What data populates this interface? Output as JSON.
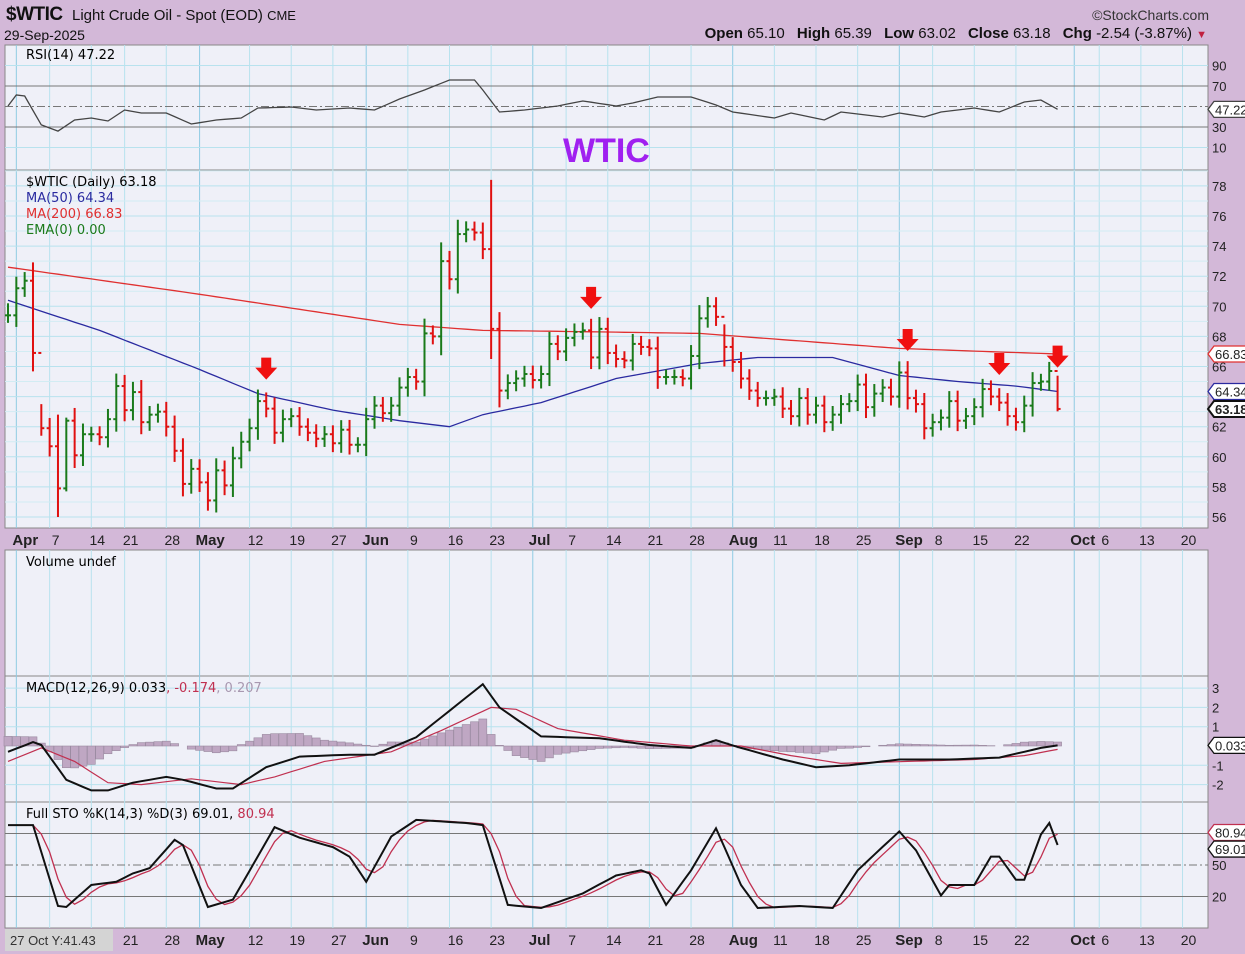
{
  "header": {
    "symbol": "$WTIC",
    "description": "Light Crude Oil - Spot (EOD)",
    "exchange": "CME",
    "date": "29-Sep-2025",
    "copyright": "©StockCharts.com",
    "open_label": "Open",
    "open": "65.10",
    "high_label": "High",
    "high": "65.39",
    "low_label": "Low",
    "low": "63.02",
    "close_label": "Close",
    "close": "63.18",
    "chg_label": "Chg",
    "chg": "-2.54 (-3.87%)"
  },
  "annotation_title": "WTIC",
  "tooltip": "27 Oct Y:41.43",
  "colors": {
    "up": "#1a7a1a",
    "down": "#e01010",
    "ma50": "#2a2aa0",
    "ma200": "#e03030",
    "title": "#a020f0",
    "signal": "#c03050",
    "hist": "#bfa7c3"
  },
  "chart_data": {
    "type": "ohlc",
    "start_date": "31-Mar-2025",
    "end_date": "29-Sep-2025",
    "closes": [
      69.4,
      71.2,
      71.7,
      66.9,
      61.9,
      60.7,
      57.9,
      62.4,
      60.1,
      61.5,
      61.5,
      61.3,
      62.5,
      64.7,
      63.1,
      64.3,
      62.3,
      62.8,
      63.0,
      62.0,
      60.4,
      58.2,
      59.2,
      58.3,
      57.1,
      59.1,
      58.1,
      59.9,
      61.0,
      61.9,
      63.7,
      63.2,
      61.6,
      62.5,
      62.7,
      62.0,
      61.6,
      61.2,
      61.5,
      60.9,
      61.8,
      60.8,
      60.8,
      62.5,
      63.4,
      62.9,
      63.4,
      64.6,
      65.3,
      65.0,
      68.2,
      68.0,
      73.0,
      71.8,
      74.8,
      75.1,
      74.9,
      73.8,
      68.5,
      64.4,
      64.9,
      65.2,
      65.5,
      65.1,
      65.5,
      67.5,
      67.0,
      67.9,
      68.3,
      68.4,
      66.6,
      68.5,
      66.9,
      66.5,
      66.4,
      67.5,
      67.3,
      67.2,
      65.3,
      65.3,
      65.3,
      65.2,
      66.7,
      69.2,
      70.0,
      69.3,
      67.3,
      66.3,
      65.2,
      64.4,
      63.9,
      63.9,
      64.0,
      63.2,
      62.7,
      63.9,
      62.8,
      63.4,
      62.3,
      62.8,
      63.5,
      63.7,
      64.8,
      63.3,
      64.2,
      64.6,
      64.0,
      65.6,
      63.9,
      63.5,
      61.9,
      62.3,
      62.6,
      63.7,
      62.4,
      62.7,
      63.3,
      64.5,
      64.0,
      63.6,
      62.7,
      62.3,
      63.4,
      64.9,
      65.0,
      65.7,
      63.18
    ],
    "bar_overrides": {
      "0": [
        70.2,
        68.9
      ],
      "4": [
        63.5,
        61.4
      ],
      "6": [
        62.8,
        56.0
      ],
      "7": [
        62.6,
        57.7
      ],
      "58": [
        78.4,
        66.5
      ],
      "86": [
        68.8,
        66.0
      ],
      "126": [
        65.39,
        63.02
      ]
    },
    "price_axis": {
      "ticks": [
        "78",
        "76",
        "74",
        "72",
        "70",
        "68",
        "66",
        "64",
        "62",
        "60",
        "58",
        "56"
      ],
      "range": [
        55.6,
        79
      ]
    },
    "legend": {
      "price": "$WTIC (Daily) 63.18",
      "ma50": "MA(50) 64.34",
      "ma200": "MA(200) 66.83",
      "ema": "EMA(0) 0.00"
    },
    "ma50": [
      [
        0,
        70.4
      ],
      [
        11,
        68.4
      ],
      [
        23,
        65.8
      ],
      [
        30,
        64.2
      ],
      [
        39,
        63.1
      ],
      [
        47,
        62.4
      ],
      [
        53,
        62.0
      ],
      [
        57,
        62.8
      ],
      [
        64,
        63.6
      ],
      [
        73,
        65.2
      ],
      [
        83,
        66.2
      ],
      [
        90,
        66.6
      ],
      [
        99,
        66.6
      ],
      [
        107,
        65.4
      ],
      [
        114,
        65.0
      ],
      [
        121,
        64.7
      ],
      [
        126,
        64.34
      ]
    ],
    "ma200": [
      [
        0,
        72.6
      ],
      [
        23,
        70.8
      ],
      [
        35,
        69.8
      ],
      [
        47,
        68.8
      ],
      [
        57,
        68.4
      ],
      [
        71,
        68.3
      ],
      [
        83,
        68.2
      ],
      [
        95,
        67.7
      ],
      [
        107,
        67.2
      ],
      [
        126,
        66.83
      ]
    ],
    "value_tags": {
      "ma200": "66.83",
      "ma50": "64.34",
      "close": "63.18"
    },
    "sell_arrows": [
      31,
      70,
      108,
      119,
      126
    ],
    "x_labels": [
      {
        "t": "Apr",
        "i": 1,
        "b": true
      },
      {
        "t": "7",
        "i": 5
      },
      {
        "t": "14",
        "i": 10
      },
      {
        "t": "21",
        "i": 14
      },
      {
        "t": "28",
        "i": 19
      },
      {
        "t": "May",
        "i": 23,
        "b": true
      },
      {
        "t": "12",
        "i": 29
      },
      {
        "t": "19",
        "i": 34
      },
      {
        "t": "27",
        "i": 39
      },
      {
        "t": "Jun",
        "i": 43,
        "b": true
      },
      {
        "t": "9",
        "i": 48
      },
      {
        "t": "16",
        "i": 53
      },
      {
        "t": "23",
        "i": 58
      },
      {
        "t": "Jul",
        "i": 63,
        "b": true
      },
      {
        "t": "7",
        "i": 67
      },
      {
        "t": "14",
        "i": 72
      },
      {
        "t": "21",
        "i": 77
      },
      {
        "t": "28",
        "i": 82
      },
      {
        "t": "Aug",
        "i": 87,
        "b": true
      },
      {
        "t": "11",
        "i": 92
      },
      {
        "t": "18",
        "i": 97
      },
      {
        "t": "25",
        "i": 102
      },
      {
        "t": "Sep",
        "i": 107,
        "b": true
      },
      {
        "t": "8",
        "i": 111
      },
      {
        "t": "15",
        "i": 116
      },
      {
        "t": "22",
        "i": 121
      },
      {
        "t": "Oct",
        "i": 128,
        "b": true
      },
      {
        "t": "6",
        "i": 131
      },
      {
        "t": "13",
        "i": 136
      },
      {
        "t": "20",
        "i": 141
      }
    ],
    "bottom_x_labels_from": 3,
    "rsi": {
      "label": "RSI(14) 47.22",
      "ticks": [
        "90",
        "70",
        "30",
        "10"
      ],
      "tag": "47.22",
      "points": [
        [
          0,
          50.5
        ],
        [
          1,
          61.2
        ],
        [
          2,
          60.2
        ],
        [
          4,
          32
        ],
        [
          6,
          26
        ],
        [
          8,
          36.8
        ],
        [
          10,
          38.8
        ],
        [
          12,
          35.9
        ],
        [
          14,
          46.6
        ],
        [
          16,
          43.7
        ],
        [
          19,
          43.7
        ],
        [
          22,
          32.9
        ],
        [
          25,
          36.8
        ],
        [
          28,
          38.8
        ],
        [
          30,
          48.5
        ],
        [
          34,
          49.5
        ],
        [
          37,
          46.6
        ],
        [
          41,
          48.5
        ],
        [
          44,
          46.6
        ],
        [
          47,
          57.3
        ],
        [
          50,
          66.1
        ],
        [
          53,
          75.9
        ],
        [
          56,
          75.9
        ],
        [
          57,
          66.1
        ],
        [
          59,
          44.6
        ],
        [
          62,
          46.6
        ],
        [
          66,
          50.5
        ],
        [
          69,
          55.4
        ],
        [
          73,
          50.5
        ],
        [
          75,
          53.4
        ],
        [
          78,
          59.3
        ],
        [
          82,
          59.3
        ],
        [
          85,
          51.5
        ],
        [
          87,
          44.6
        ],
        [
          92,
          38.8
        ],
        [
          94,
          43.7
        ],
        [
          98,
          36.8
        ],
        [
          100,
          44.6
        ],
        [
          105,
          39.8
        ],
        [
          107,
          43.7
        ],
        [
          110,
          39.8
        ],
        [
          112,
          44.6
        ],
        [
          116,
          48.5
        ],
        [
          119,
          44.6
        ],
        [
          122,
          54.4
        ],
        [
          124,
          56.3
        ],
        [
          126,
          47.22
        ]
      ]
    },
    "volume": {
      "label": "Volume undef"
    },
    "macd": {
      "label": "MACD(12,26,9)",
      "v1": "0.033",
      "v2": "-0.174",
      "v3": "0.207",
      "ticks": [
        "3",
        "2",
        "1",
        "-1",
        "-2"
      ],
      "tag": "0.033",
      "macd": [
        [
          0,
          -0.3
        ],
        [
          3,
          0.2
        ],
        [
          4,
          0.05
        ],
        [
          7,
          -1.75
        ],
        [
          10,
          -2.3
        ],
        [
          12,
          -2.3
        ],
        [
          15,
          -1.9
        ],
        [
          19,
          -1.6
        ],
        [
          21,
          -1.75
        ],
        [
          25,
          -2.2
        ],
        [
          27,
          -2.2
        ],
        [
          31,
          -1.1
        ],
        [
          35,
          -0.55
        ],
        [
          41,
          -0.45
        ],
        [
          44,
          -0.45
        ],
        [
          49,
          0.45
        ],
        [
          57,
          3.2
        ],
        [
          59,
          2.0
        ],
        [
          64,
          0.5
        ],
        [
          71,
          0.4
        ],
        [
          77,
          0.05
        ],
        [
          82,
          -0.1
        ],
        [
          85,
          0.3
        ],
        [
          88,
          -0.1
        ],
        [
          93,
          -0.7
        ],
        [
          97,
          -1.1
        ],
        [
          101,
          -1.0
        ],
        [
          107,
          -0.7
        ],
        [
          113,
          -0.7
        ],
        [
          119,
          -0.6
        ],
        [
          124,
          -0.1
        ],
        [
          126,
          0.033
        ]
      ],
      "signal": [
        [
          0,
          -0.8
        ],
        [
          4,
          -0.1
        ],
        [
          8,
          -0.8
        ],
        [
          12,
          -1.9
        ],
        [
          16,
          -2.0
        ],
        [
          22,
          -1.7
        ],
        [
          28,
          -2.0
        ],
        [
          32,
          -1.6
        ],
        [
          38,
          -0.8
        ],
        [
          46,
          -0.3
        ],
        [
          52,
          0.8
        ],
        [
          58,
          2.0
        ],
        [
          61,
          1.9
        ],
        [
          66,
          0.9
        ],
        [
          74,
          0.3
        ],
        [
          82,
          0.0
        ],
        [
          88,
          0.0
        ],
        [
          94,
          -0.5
        ],
        [
          100,
          -0.9
        ],
        [
          108,
          -0.8
        ],
        [
          116,
          -0.7
        ],
        [
          122,
          -0.5
        ],
        [
          126,
          -0.174
        ]
      ]
    },
    "sto": {
      "label": "Full STO %K(14,3) %D(3)",
      "k": "69.01",
      "d": "80.94",
      "ticks": [
        "50",
        "20"
      ],
      "tag_d": "80.94",
      "tag_k": "69.01",
      "kpoints": [
        [
          0,
          88
        ],
        [
          3,
          88
        ],
        [
          6,
          11
        ],
        [
          7,
          10
        ],
        [
          10,
          31
        ],
        [
          13,
          34
        ],
        [
          15,
          42
        ],
        [
          17,
          47
        ],
        [
          20,
          74
        ],
        [
          21,
          69
        ],
        [
          24,
          10
        ],
        [
          27,
          17
        ],
        [
          32,
          86
        ],
        [
          35,
          76
        ],
        [
          39,
          67
        ],
        [
          41,
          58
        ],
        [
          43,
          34
        ],
        [
          46,
          77
        ],
        [
          49,
          93
        ],
        [
          55,
          90
        ],
        [
          57,
          88
        ],
        [
          60,
          12
        ],
        [
          64,
          9
        ],
        [
          69,
          23
        ],
        [
          73,
          40
        ],
        [
          76,
          45
        ],
        [
          77,
          42
        ],
        [
          79,
          12
        ],
        [
          82,
          45
        ],
        [
          85,
          85
        ],
        [
          88,
          31
        ],
        [
          90,
          9
        ],
        [
          95,
          11
        ],
        [
          99,
          9
        ],
        [
          102,
          45
        ],
        [
          107,
          82
        ],
        [
          109,
          64
        ],
        [
          112,
          21
        ],
        [
          113,
          31
        ],
        [
          116,
          31
        ],
        [
          118,
          58
        ],
        [
          119,
          58
        ],
        [
          121,
          36
        ],
        [
          122,
          36
        ],
        [
          124,
          79
        ],
        [
          125,
          90
        ],
        [
          126,
          69.01
        ]
      ]
    }
  }
}
